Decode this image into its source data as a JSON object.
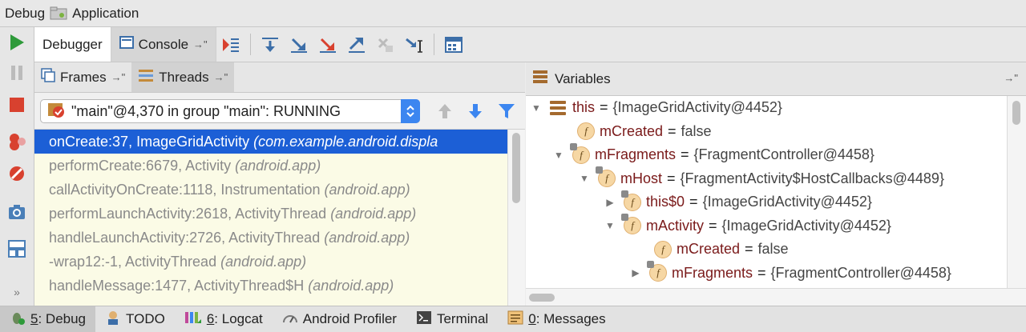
{
  "titlebar": {
    "debug_label": "Debug",
    "app_label": "Application"
  },
  "toptabs": {
    "debugger": "Debugger",
    "console": "Console"
  },
  "subtabs": {
    "frames": "Frames",
    "threads": "Threads"
  },
  "pin_glyph": "→\"",
  "thread_selector": {
    "value": "\"main\"@4,370 in group \"main\": RUNNING"
  },
  "frames": [
    {
      "method": "onCreate:37, ImageGridActivity",
      "pkg": "(com.example.android.displa"
    },
    {
      "method": "performCreate:6679, Activity",
      "pkg": "(android.app)"
    },
    {
      "method": "callActivityOnCreate:1118, Instrumentation",
      "pkg": "(android.app)"
    },
    {
      "method": "performLaunchActivity:2618, ActivityThread",
      "pkg": "(android.app)"
    },
    {
      "method": "handleLaunchActivity:2726, ActivityThread",
      "pkg": "(android.app)"
    },
    {
      "method": "-wrap12:-1, ActivityThread",
      "pkg": "(android.app)"
    },
    {
      "method": "handleMessage:1477, ActivityThread$H",
      "pkg": "(android.app)"
    }
  ],
  "variables": {
    "header": "Variables",
    "rows": [
      {
        "name": "this",
        "value": "{ImageGridActivity@4452}"
      },
      {
        "name": "mCreated",
        "value": "false"
      },
      {
        "name": "mFragments",
        "value": "{FragmentController@4458}"
      },
      {
        "name": "mHost",
        "value": "{FragmentActivity$HostCallbacks@4489}"
      },
      {
        "name": "this$0",
        "value": "{ImageGridActivity@4452}"
      },
      {
        "name": "mActivity",
        "value": "{ImageGridActivity@4452}"
      },
      {
        "name": "mCreated",
        "value": "false"
      },
      {
        "name": "mFragments",
        "value": "{FragmentController@4458}"
      }
    ]
  },
  "bottombar": {
    "debug": {
      "num": "5",
      "label": ": Debug"
    },
    "todo": "TODO",
    "logcat": {
      "num": "6",
      "label": ": Logcat"
    },
    "profiler": "Android Profiler",
    "terminal": "Terminal",
    "messages": {
      "num": "0",
      "label": ": Messages"
    }
  },
  "colors": {
    "selection": "#1c5fd6",
    "frames_bg": "#fbfbe6",
    "resume_green": "#2e9a3a",
    "stop_red": "#d8412f"
  }
}
